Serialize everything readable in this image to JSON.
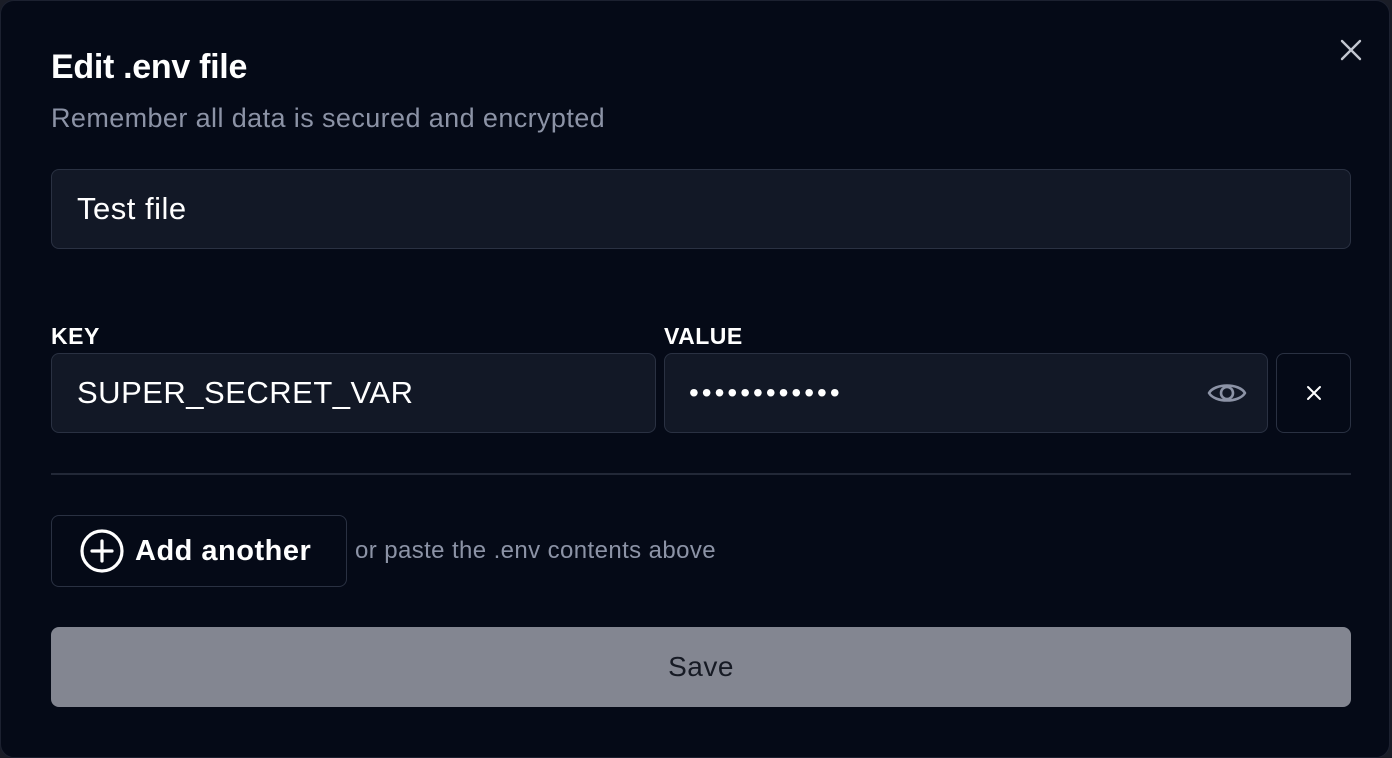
{
  "dialog": {
    "title": "Edit .env file",
    "subtitle": "Remember all data is secured and encrypted",
    "close_icon": "close-icon"
  },
  "file_name": {
    "value": "Test file"
  },
  "variables": {
    "key_header": "KEY",
    "value_header": "VALUE",
    "rows": [
      {
        "key": "SUPER_SECRET_VAR",
        "value_masked": "••••••••••••",
        "reveal_icon": "eye-icon",
        "remove_icon": "close-icon"
      }
    ]
  },
  "add_another": {
    "label": "Add another",
    "icon": "plus-circle-icon",
    "hint": "or paste the .env contents above"
  },
  "save": {
    "label": "Save"
  },
  "colors": {
    "background": "#050a17",
    "field_background": "#121826",
    "border": "#2a3142",
    "muted_text": "#8c93a6",
    "save_disabled": "#838691"
  }
}
